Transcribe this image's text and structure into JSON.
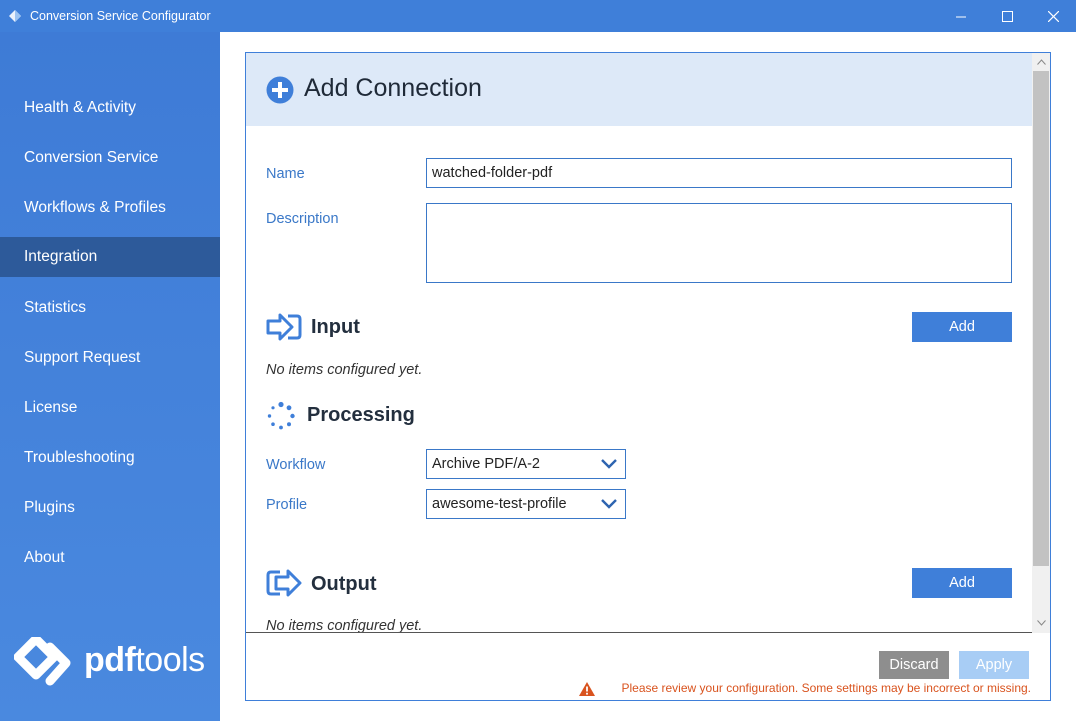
{
  "window": {
    "title": "Conversion Service Configurator",
    "accent": "#3f7fd9"
  },
  "sidebar": {
    "items": [
      {
        "label": "Health & Activity"
      },
      {
        "label": "Conversion Service"
      },
      {
        "label": "Workflows & Profiles"
      },
      {
        "label": "Integration",
        "active": true
      },
      {
        "label": "Statistics"
      },
      {
        "label": "Support Request"
      },
      {
        "label": "License"
      },
      {
        "label": "Troubleshooting"
      },
      {
        "label": "Plugins"
      },
      {
        "label": "About"
      }
    ],
    "logo": {
      "bold": "pdf",
      "regular": "tools"
    }
  },
  "main": {
    "title": "Add Connection",
    "name_label": "Name",
    "name_value": "watched-folder-pdf",
    "description_label": "Description",
    "description_value": "",
    "input": {
      "title": "Input",
      "add_label": "Add",
      "empty": "No items configured yet."
    },
    "processing": {
      "title": "Processing",
      "workflow_label": "Workflow",
      "workflow_value": "Archive PDF/A-2",
      "profile_label": "Profile",
      "profile_value": "awesome-test-profile"
    },
    "output": {
      "title": "Output",
      "add_label": "Add",
      "empty": "No items configured yet."
    }
  },
  "footer": {
    "discard_label": "Discard",
    "apply_label": "Apply",
    "warning": "Please review your configuration. Some settings may be incorrect or missing."
  },
  "icons": [
    "app-icon",
    "minimize-icon",
    "maximize-icon",
    "close-icon",
    "plus-circle-icon",
    "input-arrow-icon",
    "processing-spinner-icon",
    "output-arrow-icon",
    "chevron-down-icon",
    "warning-icon",
    "scroll-up-icon",
    "scroll-down-icon",
    "pdftools-logo-icon"
  ]
}
